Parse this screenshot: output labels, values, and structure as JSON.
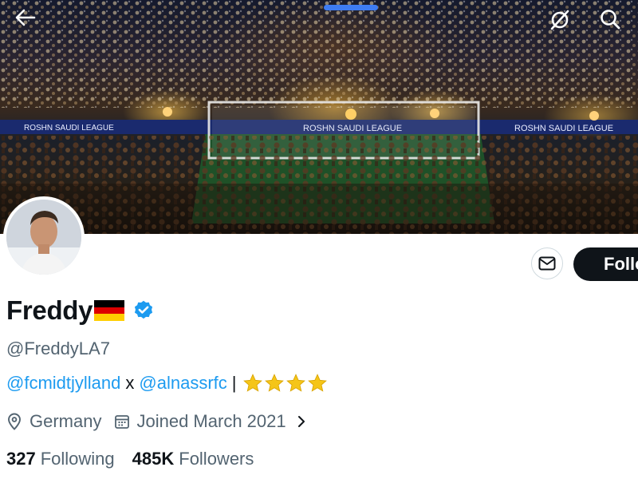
{
  "banner": {
    "ad_board_text": "ROSHN SAUDI LEAGUE"
  },
  "profile": {
    "display_name": "Freddy",
    "flag": "🇩🇪",
    "handle": "@FreddyLA7",
    "bio": {
      "mention_1": "@fcmidtjylland",
      "separator": "x",
      "mention_2": "@alnassrfc",
      "divider": "|",
      "star_count": 4
    },
    "location": "Germany",
    "joined": "Joined March 2021",
    "following_count": "327",
    "following_label": "Following",
    "followers_count": "485K",
    "followers_label": "Followers"
  },
  "actions": {
    "follow_label": "Follow"
  },
  "icons": {
    "back": "arrow-left-icon",
    "grok": "grok-icon",
    "search": "search-icon",
    "message": "envelope-icon",
    "verified": "verified-badge-icon",
    "location": "location-pin-icon",
    "calendar": "calendar-icon",
    "chevron": "chevron-right-icon"
  },
  "colors": {
    "accent": "#1d9bf0",
    "text_primary": "#0f1419",
    "text_secondary": "#536471",
    "follow_bg": "#0f1419",
    "star": "#f5c518"
  }
}
